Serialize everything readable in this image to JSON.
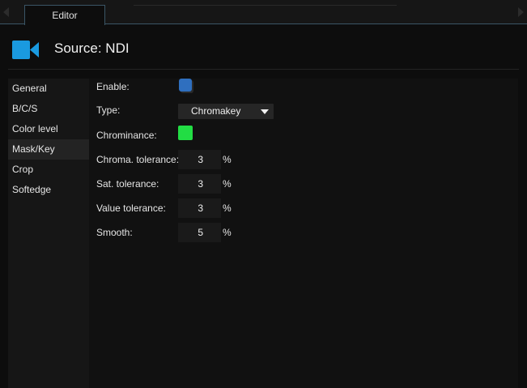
{
  "tabs": {
    "editor_label": "Editor"
  },
  "header": {
    "title": "Source: NDI",
    "icon": "video-camera-icon",
    "icon_color": "#1a9ae0"
  },
  "sidebar": {
    "items": [
      {
        "label": "General"
      },
      {
        "label": "B/C/S"
      },
      {
        "label": "Color level"
      },
      {
        "label": "Mask/Key",
        "active": true
      },
      {
        "label": "Crop"
      },
      {
        "label": "Softedge"
      }
    ]
  },
  "form": {
    "enable": {
      "label": "Enable:",
      "checked": true,
      "color": "#2f6fbf"
    },
    "type": {
      "label": "Type:",
      "value": "Chromakey"
    },
    "chrominance": {
      "label": "Chrominance:",
      "color": "#22dd44"
    },
    "chroma_tolerance": {
      "label": "Chroma. tolerance:",
      "value": "3",
      "unit": "%"
    },
    "sat_tolerance": {
      "label": "Sat. tolerance:",
      "value": "3",
      "unit": "%"
    },
    "value_tolerance": {
      "label": "Value tolerance:",
      "value": "3",
      "unit": "%"
    },
    "smooth": {
      "label": "Smooth:",
      "value": "5",
      "unit": "%"
    }
  }
}
